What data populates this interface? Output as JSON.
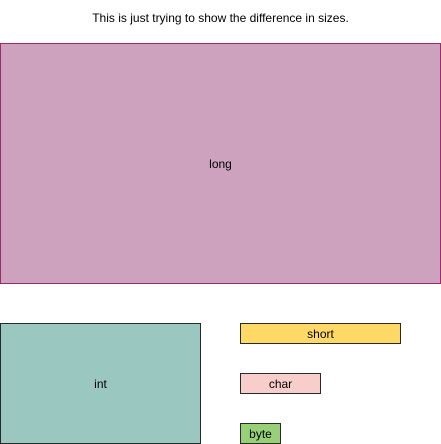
{
  "caption": "This is just trying to show the difference in sizes.",
  "boxes": {
    "long": {
      "label": "long",
      "fill": "#cda2be",
      "stroke": "#9c2b6b"
    },
    "int": {
      "label": "int",
      "fill": "#9ac7bf",
      "stroke": "#2a2a2a"
    },
    "short": {
      "label": "short",
      "fill": "#ffd966",
      "stroke": "#2a2a2a"
    },
    "char": {
      "label": "char",
      "fill": "#f8cecc",
      "stroke": "#2a2a2a"
    },
    "byte": {
      "label": "byte",
      "fill": "#97d077",
      "stroke": "#2a2a2a"
    }
  }
}
